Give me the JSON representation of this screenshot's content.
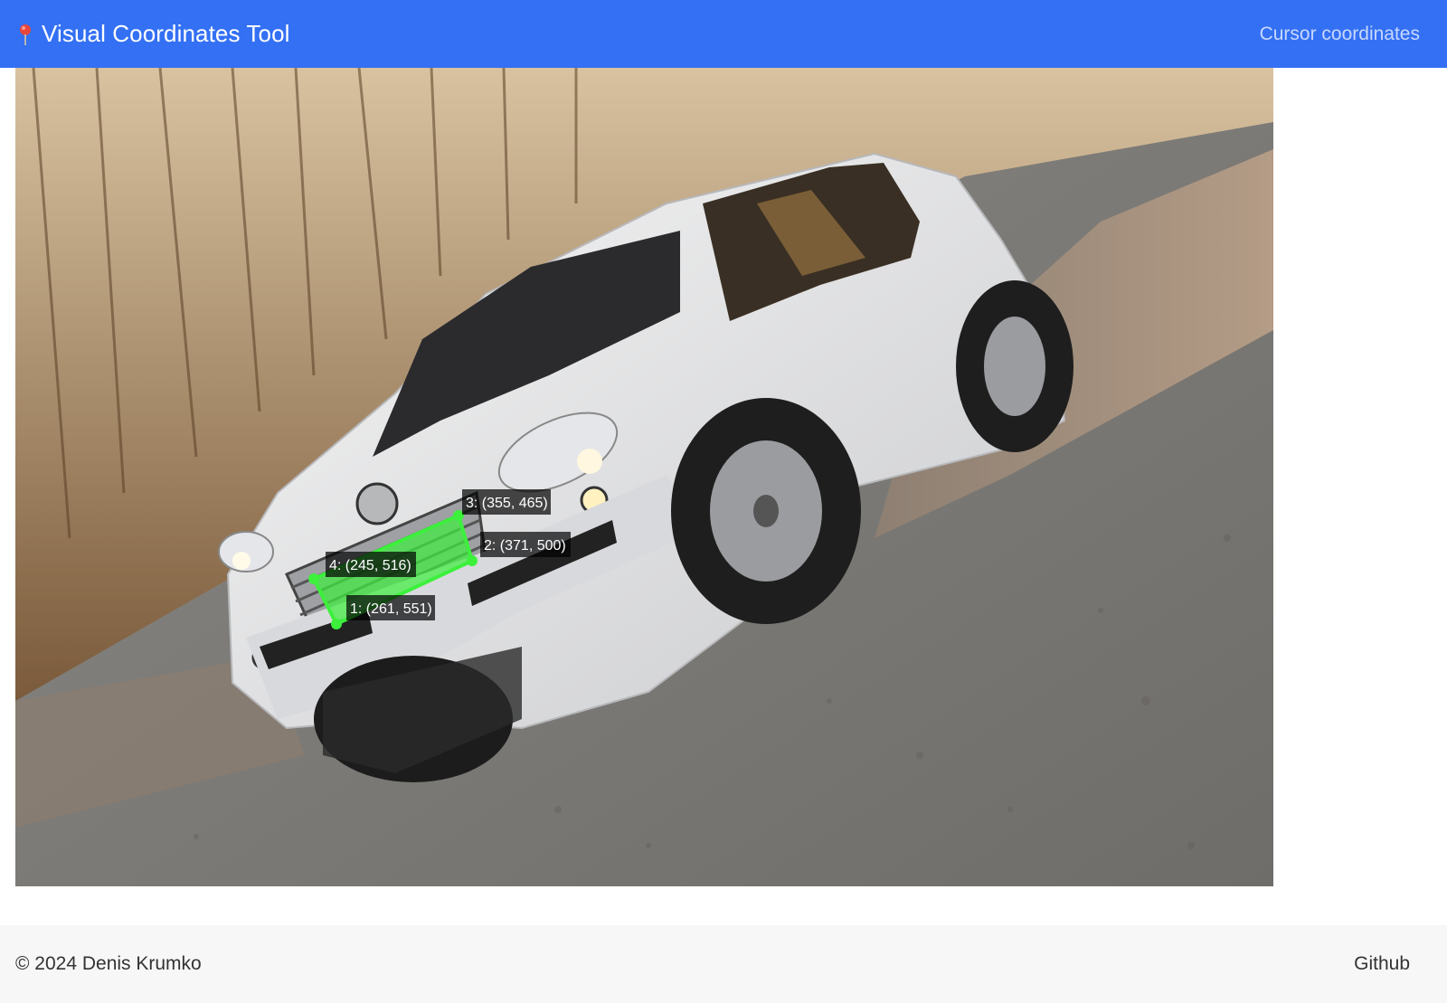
{
  "app": {
    "title": "Visual Coordinates Tool",
    "icon": "map-pin-icon"
  },
  "nav": {
    "cursor_coordinates_label": "Cursor coordinates"
  },
  "canvas": {
    "image_description": "photo",
    "annotation_color": "#3cf03c",
    "points": [
      {
        "label": "1: (261, 551)"
      },
      {
        "label": "2: (371, 500)"
      },
      {
        "label": "3: (355, 465)"
      },
      {
        "label": "4: (245, 516)"
      }
    ]
  },
  "footer": {
    "copyright": "© 2024 Denis Krumko",
    "github_label": "Github"
  },
  "colors": {
    "navbar": "#3370f3",
    "footer_bg": "#f7f7f7"
  }
}
